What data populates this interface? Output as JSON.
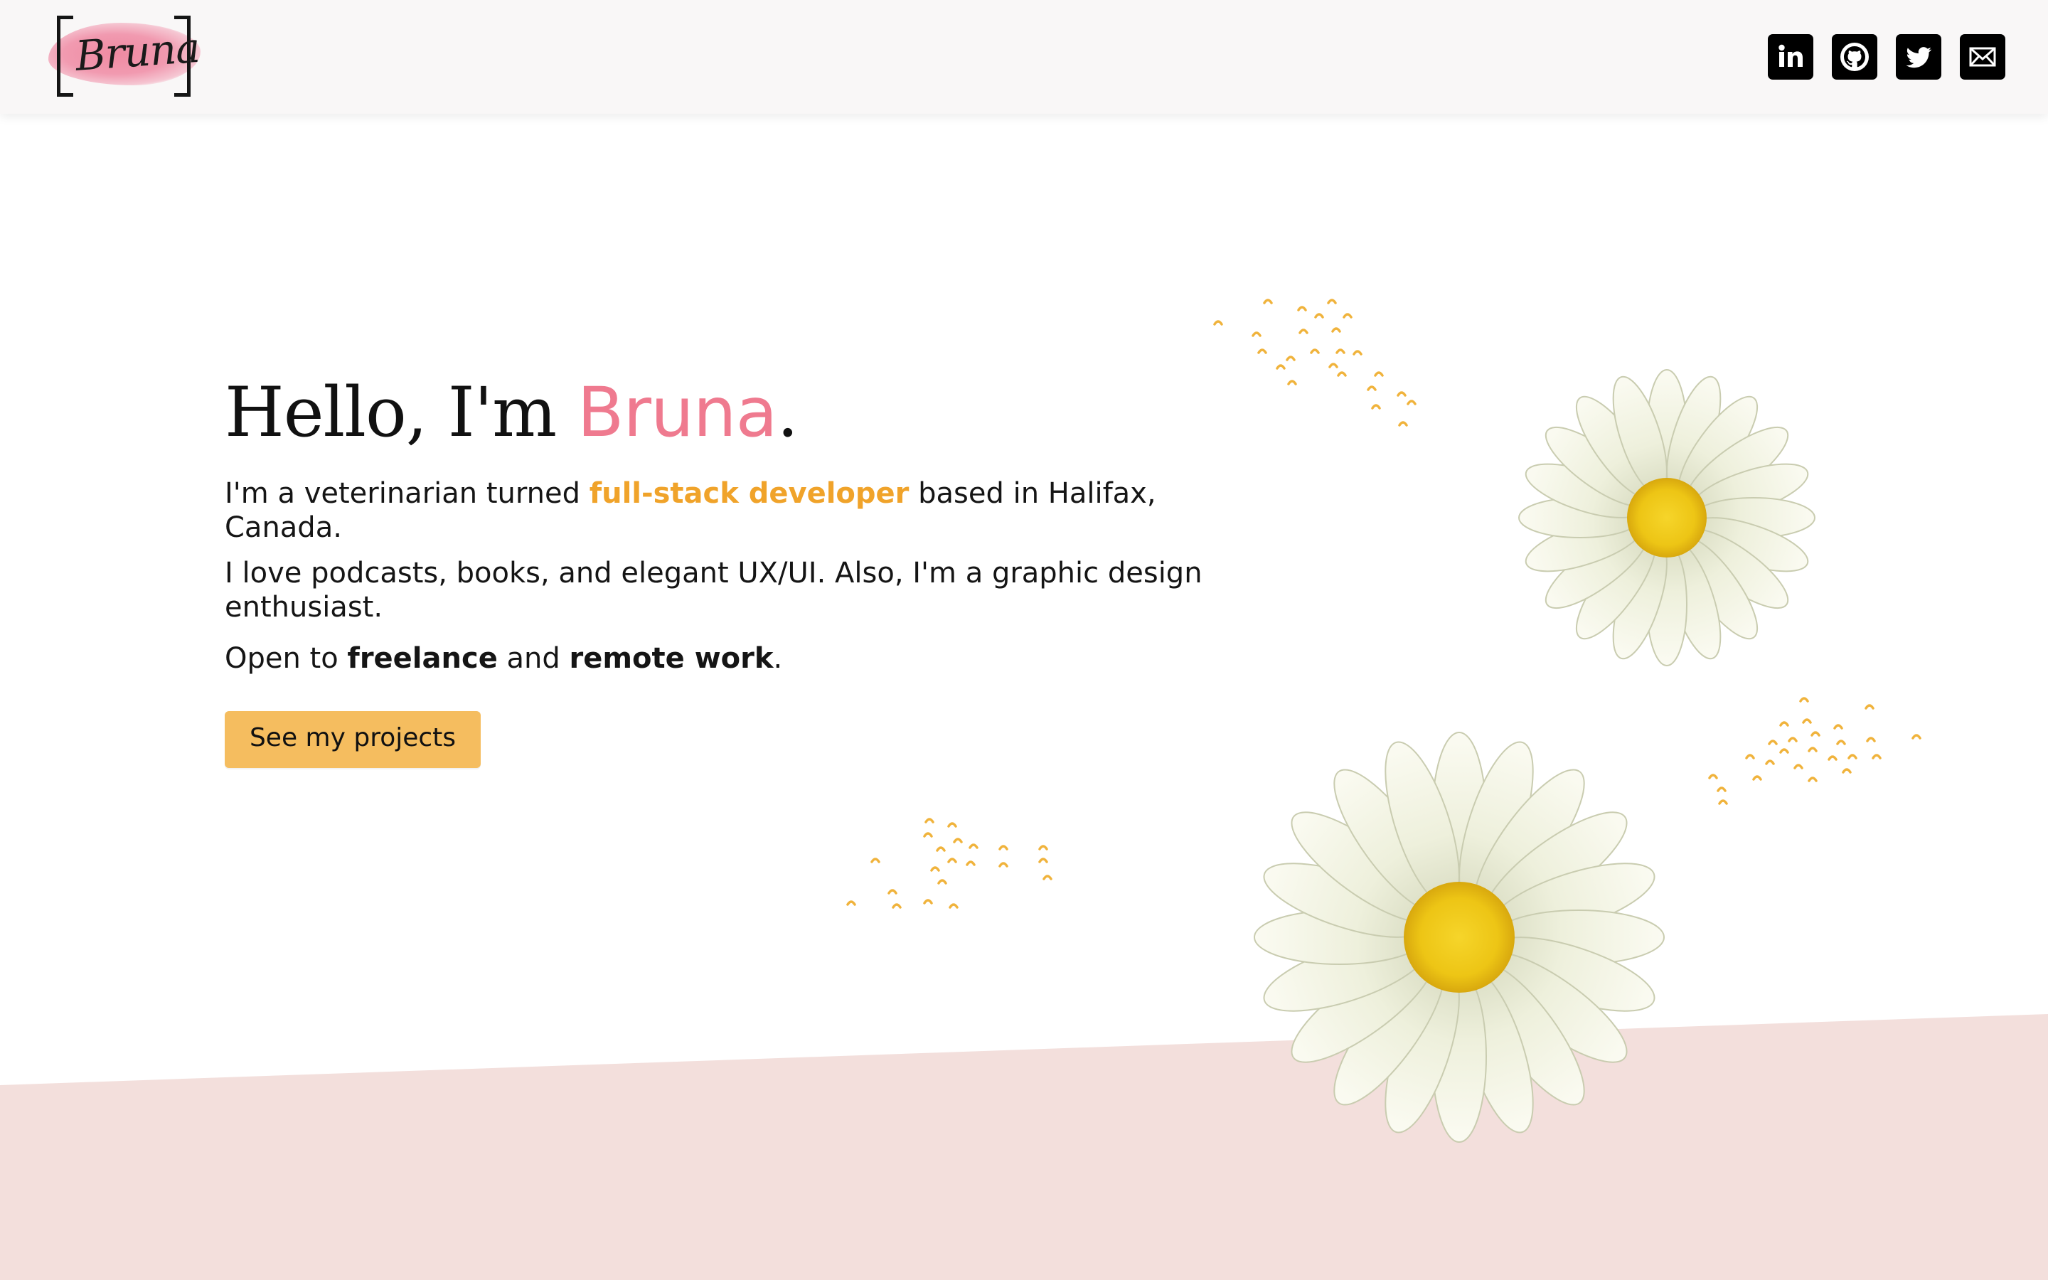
{
  "header": {
    "logo_text": "Bruna",
    "social": [
      {
        "name": "linkedin-icon"
      },
      {
        "name": "github-icon"
      },
      {
        "name": "twitter-icon"
      },
      {
        "name": "email-icon"
      }
    ]
  },
  "hero": {
    "greeting_prefix": "Hello, I'm ",
    "greeting_name": "Bruna",
    "greeting_suffix": ".",
    "line1_a": "I'm a veterinarian turned ",
    "line1_accent": "full-stack developer",
    "line1_b": " based in Halifax, Canada.",
    "line2": "I love podcasts, books, and elegant UX/UI. Also, I'm a graphic design enthusiast.",
    "line3_a": "Open to ",
    "line3_b": "freelance",
    "line3_c": " and ",
    "line3_d": "remote work",
    "line3_e": ".",
    "cta_label": "See my projects"
  },
  "colors": {
    "accent_pink": "#ef7a8f",
    "accent_orange": "#f0a32a",
    "button": "#f5bd5f",
    "bottom_band": "#f3dfdc"
  }
}
